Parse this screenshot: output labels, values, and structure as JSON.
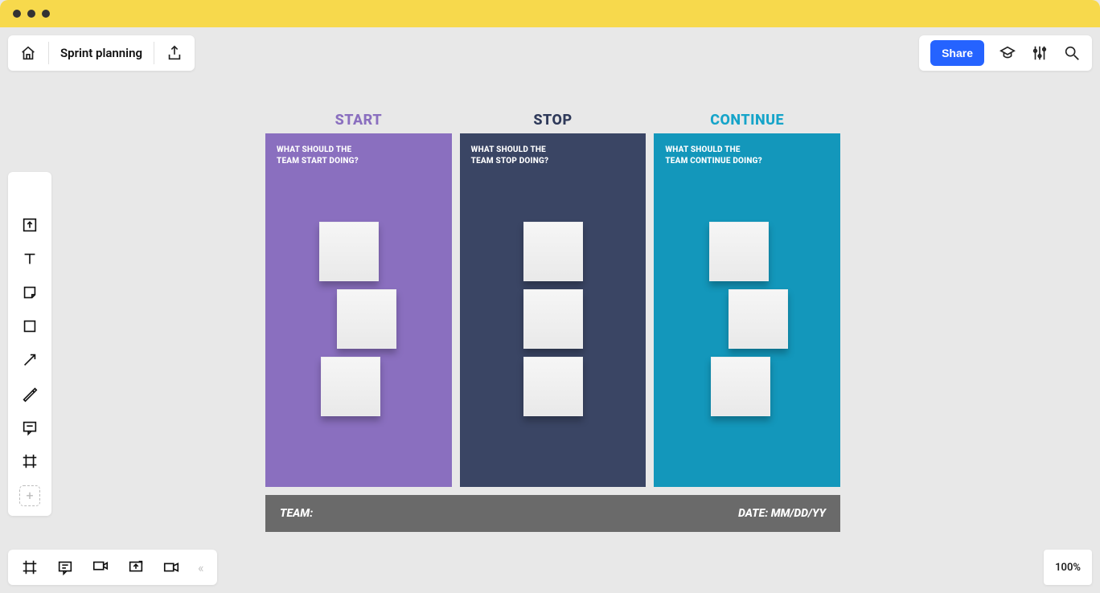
{
  "header": {
    "title": "Sprint planning",
    "share_label": "Share"
  },
  "board": {
    "columns": [
      {
        "title": "START",
        "color_header": "#8a6fbf",
        "color_bg": "#8a6fbf",
        "prompt": "WHAT SHOULD THE\nTEAM START DOING?"
      },
      {
        "title": "STOP",
        "color_header": "#2f3a5a",
        "color_bg": "#3a4564",
        "prompt": "WHAT SHOULD THE\nTEAM STOP DOING?"
      },
      {
        "title": "CONTINUE",
        "color_header": "#16a4c9",
        "color_bg": "#1397bb",
        "prompt": "WHAT SHOULD THE\nTEAM CONTINUE DOING?"
      }
    ],
    "footer": {
      "team_label": "TEAM:",
      "date_label": "DATE: MM/DD/YY"
    }
  },
  "zoom": "100%"
}
